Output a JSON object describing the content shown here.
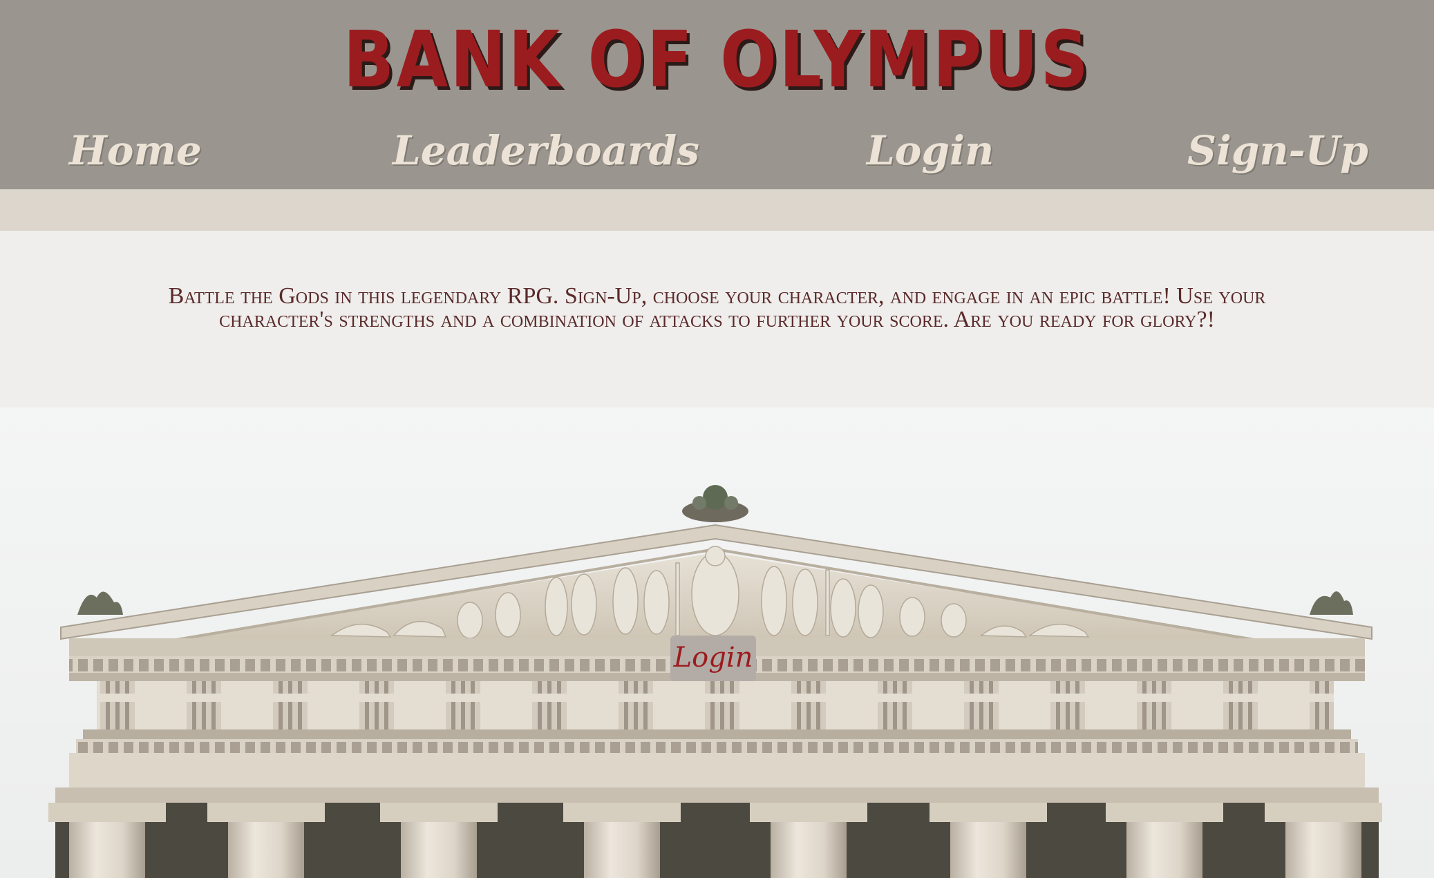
{
  "site": {
    "title": "BANK OF OLYMPUS"
  },
  "nav": {
    "home": "Home",
    "leaderboards": "Leaderboards",
    "login": "Login",
    "signup": "Sign-Up"
  },
  "intro": {
    "tagline": "Battle the Gods in this legendary RPG. Sign-Up, choose your character, and engage in an epic battle! Use your character's strengths and a combination of attacks to further your score. Are you ready for glory?!"
  },
  "hero": {
    "login_button": "Login"
  },
  "colors": {
    "header_bg": "#9a968f",
    "title_red": "#9b1c1f",
    "nav_text": "#ece3d6",
    "tagline_text": "#5a2a2a",
    "page_bg": "#efeeec"
  }
}
